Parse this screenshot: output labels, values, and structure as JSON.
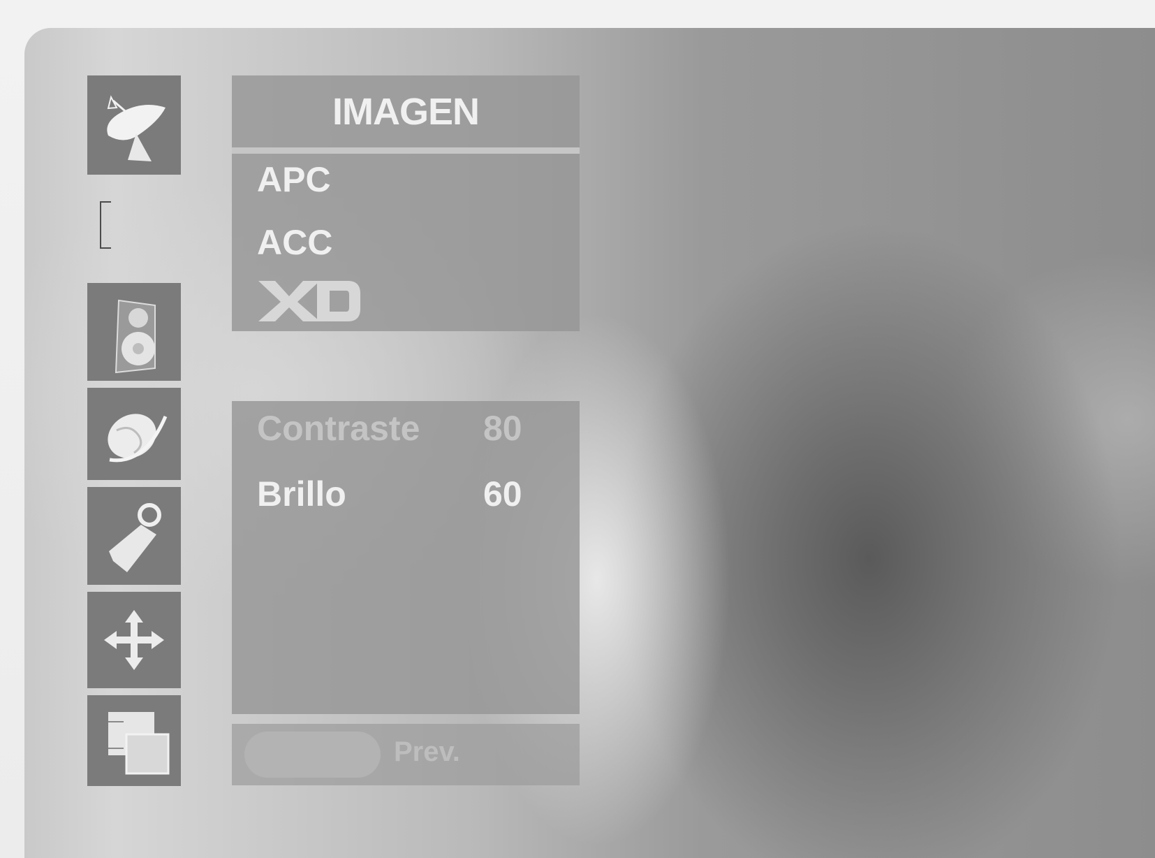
{
  "menu": {
    "title": "IMAGEN",
    "items": [
      {
        "label": "APC"
      },
      {
        "label": "ACC"
      },
      {
        "label": "XD"
      }
    ]
  },
  "submenu": {
    "rows": [
      {
        "label": "Contraste",
        "value": "80",
        "dimmed": true
      },
      {
        "label": "Brillo",
        "value": "60",
        "dimmed": false
      }
    ]
  },
  "footer": {
    "prev_label": "Prev."
  },
  "sidebar_icons": [
    "satellite-dish-icon",
    "speaker-icon",
    "globe-icon",
    "key-tag-icon",
    "move-arrows-icon",
    "windows-icon"
  ],
  "colors": {
    "tile": "#7b7b7b",
    "panel": "#969696",
    "text_active": "#f0f0f0",
    "text_dimmed": "#c4c4c4"
  }
}
